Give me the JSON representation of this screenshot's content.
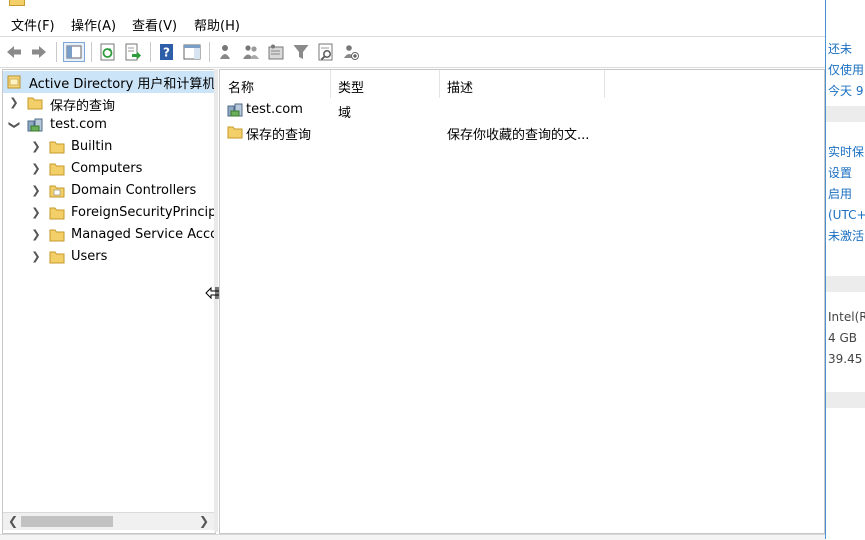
{
  "menubar": {
    "items": [
      "文件(F)",
      "操作(A)",
      "查看(V)",
      "帮助(H)"
    ]
  },
  "toolbar": {
    "buttons": [
      "back-icon",
      "forward-icon",
      "show-hide-console-tree-icon",
      "refresh-icon",
      "export-list-icon",
      "help-icon",
      "show-action-pane-icon",
      "users-icon",
      "groups-icon",
      "ou-icon",
      "filter-icon",
      "find-icon",
      "add-to-group-icon"
    ]
  },
  "tree": {
    "root": "Active Directory 用户和计算机",
    "saved_queries": "保存的查询",
    "domain": "test.com",
    "children": [
      "Builtin",
      "Computers",
      "Domain Controllers",
      "ForeignSecurityPrincipals",
      "Managed Service Accounts",
      "Users"
    ]
  },
  "list": {
    "columns": [
      "名称",
      "类型",
      "描述"
    ],
    "rows": [
      {
        "name": "test.com",
        "type": "域",
        "description": ""
      },
      {
        "name": "保存的查询",
        "type": "",
        "description": "保存你收藏的查询的文..."
      }
    ]
  },
  "side_panel": {
    "items": [
      "还未",
      "仅使用",
      "今天 9",
      "实时保",
      "设置",
      "启用",
      "(UTC+",
      "未激活",
      "Intel(R",
      "4 GB",
      "39.45"
    ]
  },
  "colors": {
    "selection": "#cce4f7",
    "folder": "#f3cf6a",
    "link": "#1a6fc2"
  }
}
